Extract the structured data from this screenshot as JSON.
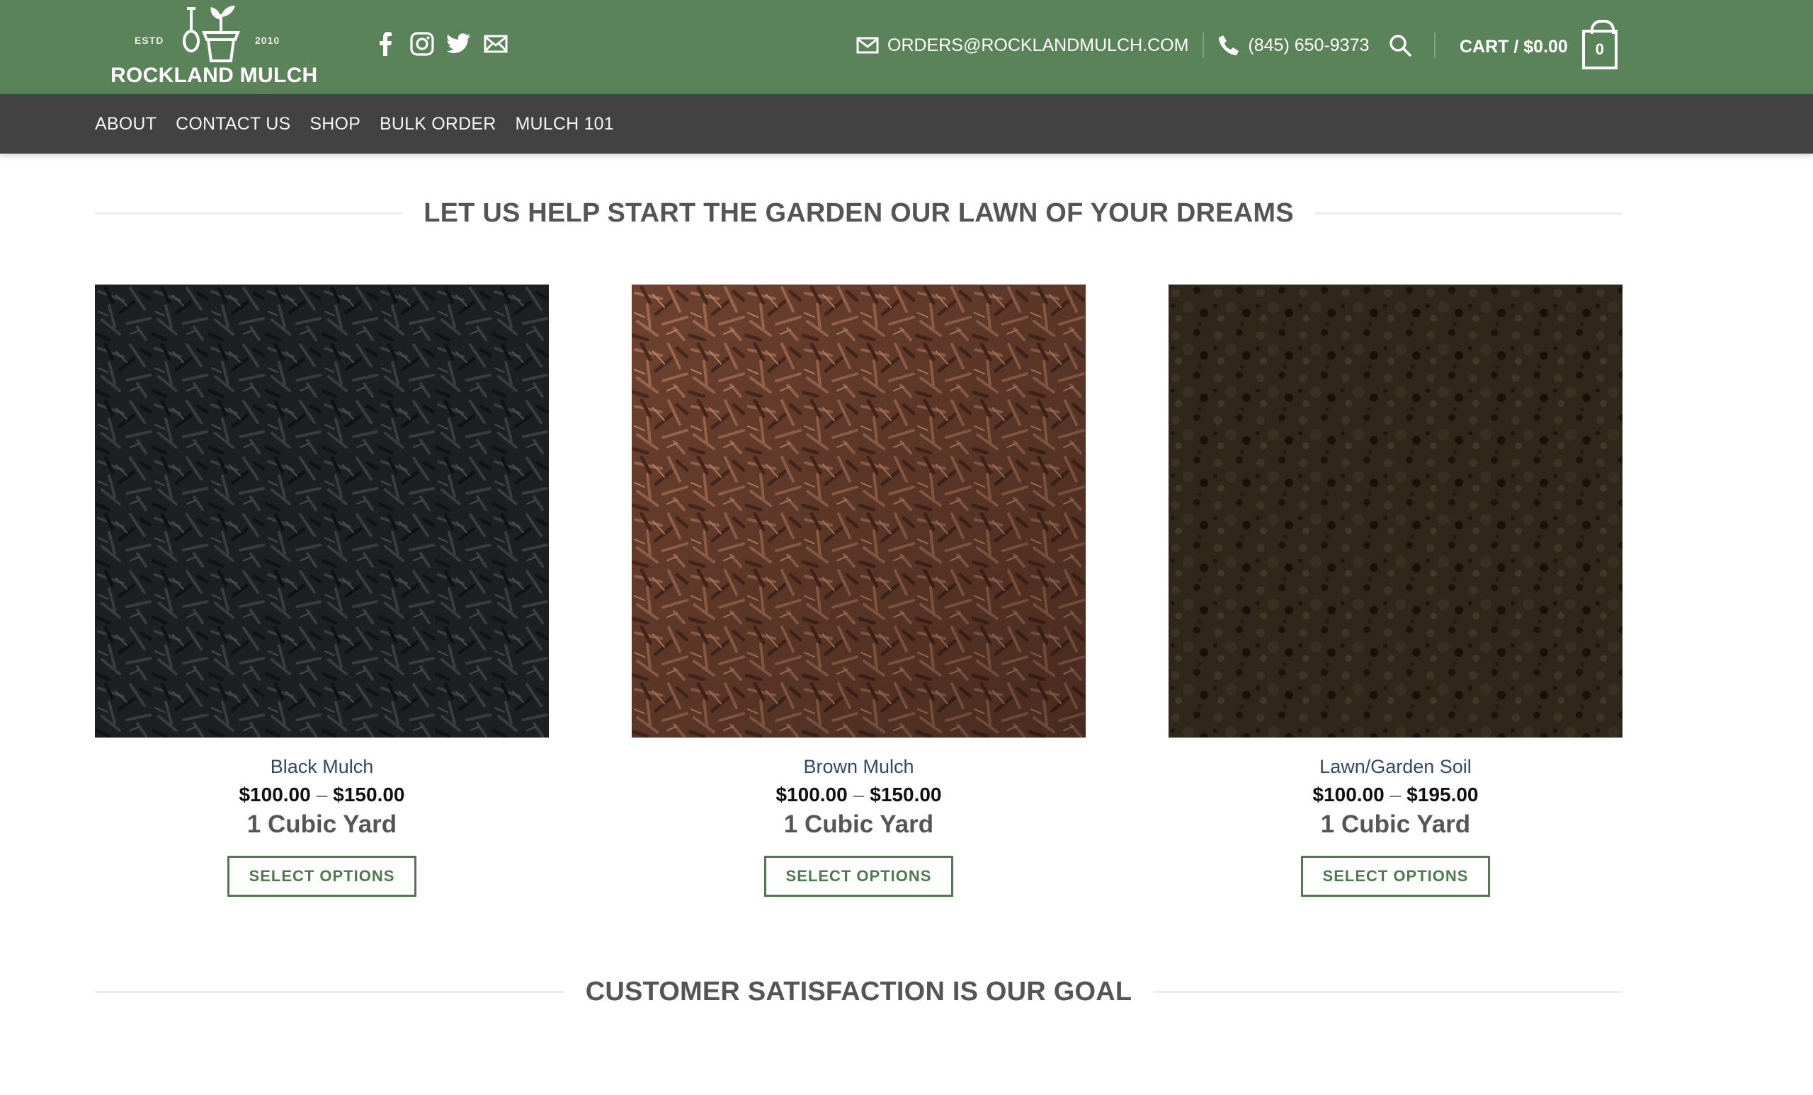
{
  "brand": {
    "name": "ROCKLAND MULCH",
    "estd_label": "ESTD",
    "year": "2010",
    "color_primary": "#5a835a",
    "color_nav": "#424242"
  },
  "social": [
    {
      "icon": "facebook-icon"
    },
    {
      "icon": "instagram-icon"
    },
    {
      "icon": "twitter-icon"
    },
    {
      "icon": "email-icon"
    }
  ],
  "header": {
    "email": "ORDERS@ROCKLANDMULCH.COM",
    "phone": "(845) 650-9373",
    "cart_label": "CART / $0.00",
    "cart_count": "0"
  },
  "nav": {
    "items": [
      "ABOUT",
      "CONTACT US",
      "SHOP",
      "BULK ORDER",
      "MULCH 101"
    ]
  },
  "sections": {
    "products_title": "LET US HELP START THE GARDEN OUR LAWN OF YOUR DREAMS",
    "satisfaction_title": "CUSTOMER SATISFACTION IS OUR GOAL"
  },
  "products": [
    {
      "name": "Black Mulch",
      "price_low": "$100.00",
      "price_sep": "–",
      "price_high": "$150.00",
      "unit": "1 Cubic Yard",
      "button": "SELECT OPTIONS",
      "image_color": "#1c1d1f"
    },
    {
      "name": "Brown Mulch",
      "price_low": "$100.00",
      "price_sep": "–",
      "price_high": "$150.00",
      "unit": "1 Cubic Yard",
      "button": "SELECT OPTIONS",
      "image_color": "#7a4a35"
    },
    {
      "name": "Lawn/Garden Soil",
      "price_low": "$100.00",
      "price_sep": "–",
      "price_high": "$195.00",
      "unit": "1 Cubic Yard",
      "button": "SELECT OPTIONS",
      "image_color": "#2e261a"
    }
  ]
}
